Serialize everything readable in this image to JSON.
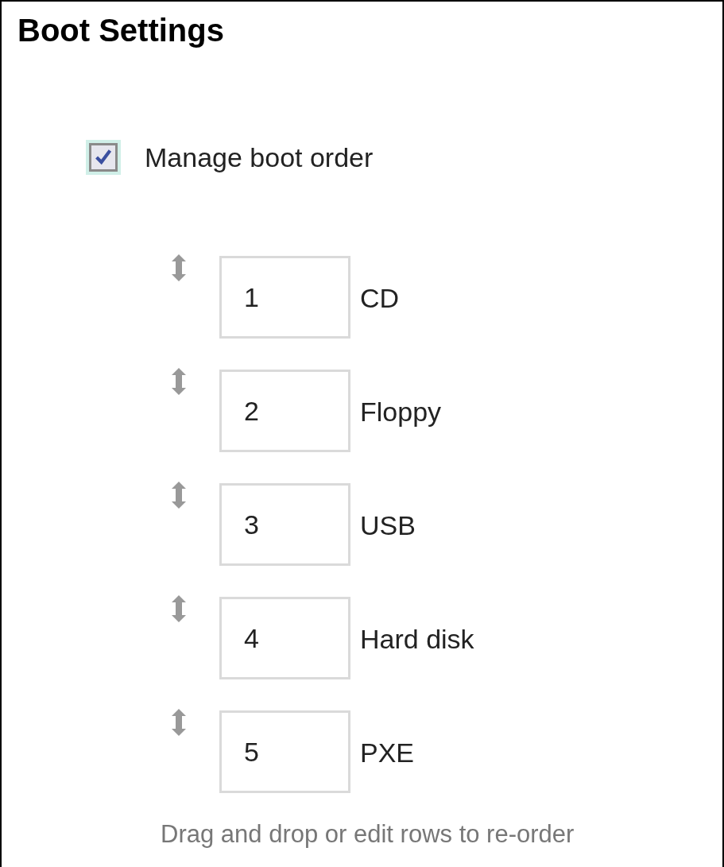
{
  "title": "Boot Settings",
  "manage_boot_order": {
    "label": "Manage boot order",
    "checked": true
  },
  "boot_devices": [
    {
      "order": "1",
      "name": "CD"
    },
    {
      "order": "2",
      "name": "Floppy"
    },
    {
      "order": "3",
      "name": "USB"
    },
    {
      "order": "4",
      "name": "Hard disk"
    },
    {
      "order": "5",
      "name": "PXE"
    }
  ],
  "hint": "Drag and drop or edit rows to re-order"
}
